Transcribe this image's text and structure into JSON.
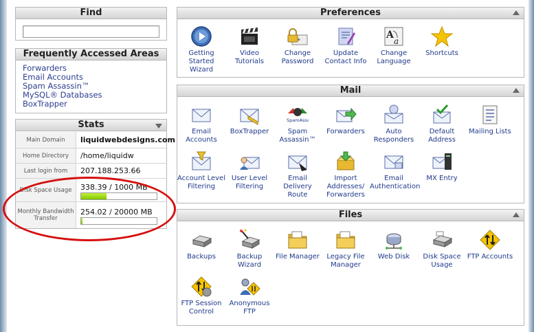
{
  "find": {
    "title": "Find",
    "search_value": ""
  },
  "faa": {
    "title": "Frequently Accessed Areas",
    "links": [
      "Forwarders",
      "Email Accounts",
      "Spam Assassin™",
      "MySQL® Databases",
      "BoxTrapper"
    ]
  },
  "stats": {
    "title": "Stats",
    "main_domain_label": "Main Domain",
    "main_domain": "liquidwebdesigns.com",
    "home_dir_label": "Home Directory",
    "home_dir": "/home/liquidw",
    "last_login_label": "Last login from",
    "last_login": "207.188.253.66",
    "disk_label": "Disk Space Usage",
    "disk_value": "338.39 / 1000 MB",
    "disk_fraction": 0.338,
    "bandwidth_label": "Monthly Bandwidth Transfer",
    "bandwidth_value": "254.02 / 20000 MB",
    "bandwidth_fraction": 0.0127
  },
  "preferences": {
    "title": "Preferences",
    "items": [
      {
        "label": "Getting Started Wizard",
        "icon": "wizard-icon"
      },
      {
        "label": "Video Tutorials",
        "icon": "video-icon"
      },
      {
        "label": "Change Password",
        "icon": "password-icon"
      },
      {
        "label": "Update Contact Info",
        "icon": "contact-icon"
      },
      {
        "label": "Change Language",
        "icon": "language-icon"
      },
      {
        "label": "Shortcuts",
        "icon": "star-icon"
      }
    ]
  },
  "mail": {
    "title": "Mail",
    "items": [
      {
        "label": "Email Accounts",
        "icon": "envelope-icon"
      },
      {
        "label": "BoxTrapper",
        "icon": "boxtrapper-icon"
      },
      {
        "label": "Spam Assassin™",
        "icon": "spamassassin-icon",
        "badge": "SpamAssassin"
      },
      {
        "label": "Forwarders",
        "icon": "forward-icon"
      },
      {
        "label": "Auto Responders",
        "icon": "autoresponder-icon"
      },
      {
        "label": "Default Address",
        "icon": "default-address-icon"
      },
      {
        "label": "Mailing Lists",
        "icon": "mailing-list-icon"
      },
      {
        "label": "Account Level Filtering",
        "icon": "filter-icon"
      },
      {
        "label": "User Level Filtering",
        "icon": "user-filter-icon"
      },
      {
        "label": "Email Delivery Route",
        "icon": "delivery-route-icon"
      },
      {
        "label": "Import Addresses/ Forwarders",
        "icon": "import-icon"
      },
      {
        "label": "Email Authentication",
        "icon": "authentication-icon"
      },
      {
        "label": "MX Entry",
        "icon": "mx-icon"
      }
    ]
  },
  "files": {
    "title": "Files",
    "items": [
      {
        "label": "Backups",
        "icon": "backup-drive-icon"
      },
      {
        "label": "Backup Wizard",
        "icon": "backup-wizard-icon"
      },
      {
        "label": "File Manager",
        "icon": "folder-icon"
      },
      {
        "label": "Legacy File Manager",
        "icon": "legacy-folder-icon"
      },
      {
        "label": "Web Disk",
        "icon": "web-disk-icon"
      },
      {
        "label": "Disk Space Usage",
        "icon": "disk-usage-icon"
      },
      {
        "label": "FTP Accounts",
        "icon": "ftp-icon"
      },
      {
        "label": "FTP Session Control",
        "icon": "ftp-session-icon"
      },
      {
        "label": "Anonymous FTP",
        "icon": "anonymous-ftp-icon"
      }
    ]
  },
  "colors": {
    "link": "#2c3e8e",
    "annotation": "#d60f0f",
    "bar_fill": "#7fc800"
  }
}
